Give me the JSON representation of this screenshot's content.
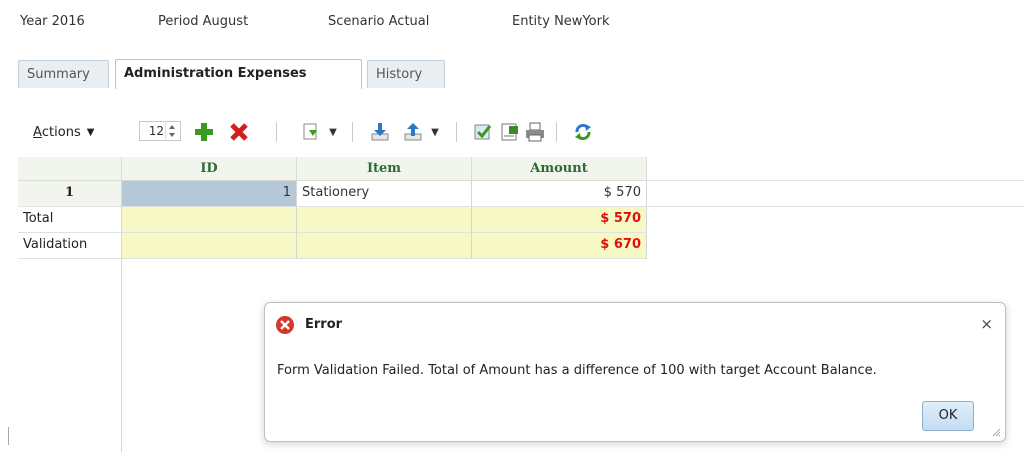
{
  "pov": {
    "year": "Year  2016",
    "period": "Period  August",
    "scenario": "Scenario  Actual",
    "entity": "Entity  NewYork"
  },
  "tabs": [
    {
      "label": "Summary",
      "active": false
    },
    {
      "label": "Administration Expenses",
      "active": true
    },
    {
      "label": "History",
      "active": false
    }
  ],
  "toolbar": {
    "actions_label_prefix": "A",
    "actions_label_rest": "ctions",
    "row_count": "12"
  },
  "grid": {
    "columns": [
      "ID",
      "Item",
      "Amount"
    ],
    "rows": [
      {
        "header": "1",
        "id": "1",
        "item": "Stationery",
        "amount": "$ 570"
      }
    ],
    "total": {
      "label": "Total",
      "amount": "$ 570"
    },
    "validation": {
      "label": "Validation",
      "amount": "$ 670"
    }
  },
  "dialog": {
    "title": "Error",
    "message": "Form Validation Failed. Total of Amount has a difference of 100 with target Account Balance.",
    "ok_label": "OK",
    "close_glyph": "×"
  },
  "colors": {
    "header_text": "#2e6b33",
    "error_red": "#e01010",
    "yellow_cell": "#f7f9c5",
    "id_cell": "#b4c8d8"
  }
}
